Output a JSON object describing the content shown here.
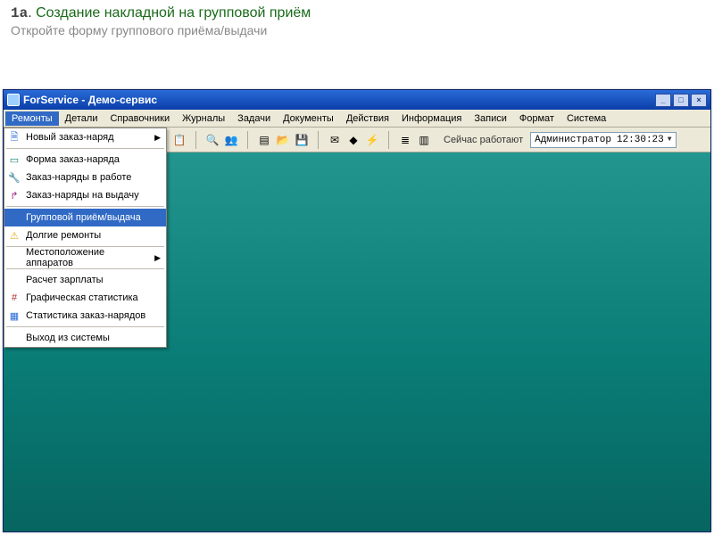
{
  "slide": {
    "number": "1a",
    "dot": ".",
    "title": "Создание накладной на групповой приём",
    "subtitle": "Откройте форму группового приёма/выдачи"
  },
  "window": {
    "title": "ForService - Демо-сервис",
    "controls": {
      "min": "_",
      "max": "□",
      "close": "×"
    }
  },
  "menubar": {
    "items": [
      "Ремонты",
      "Детали",
      "Справочники",
      "Журналы",
      "Задачи",
      "Документы",
      "Действия",
      "Информация",
      "Записи",
      "Формат",
      "Система"
    ],
    "activeIndex": 0
  },
  "dropdown": {
    "items": [
      {
        "label": "Новый заказ-наряд",
        "icon": "doc",
        "submenu": true
      },
      {
        "sep": true
      },
      {
        "label": "Форма заказ-наряда",
        "icon": "form"
      },
      {
        "label": "Заказ-наряды в работе",
        "icon": "wrench"
      },
      {
        "label": "Заказ-наряды на выдачу",
        "icon": "out"
      },
      {
        "sep": true
      },
      {
        "label": "Групповой приём/выдача",
        "selected": true
      },
      {
        "label": "Долгие ремонты",
        "icon": "warn"
      },
      {
        "sep": true
      },
      {
        "label": "Местоположение аппаратов",
        "submenu": true
      },
      {
        "sep": true
      },
      {
        "label": "Расчет зарплаты"
      },
      {
        "label": "Графическая статистика",
        "icon": "stat"
      },
      {
        "label": "Статистика заказ-нарядов",
        "icon": "table"
      },
      {
        "sep": true
      },
      {
        "label": "Выход из системы"
      }
    ]
  },
  "toolbar": {
    "status_label": "Сейчас работают",
    "user": "Администратор",
    "time": "12:30:23"
  },
  "icons": {
    "doc": "🗎",
    "form": "▭",
    "wrench": "🔧",
    "out": "↱",
    "warn": "⚠",
    "stat": "#",
    "table": "▦",
    "copy": "⧉",
    "paste": "📋",
    "search": "🔍",
    "people": "👥",
    "page": "▤",
    "folder": "📂",
    "disk": "💾",
    "mail": "✉",
    "tag": "◆",
    "bolt": "⚡",
    "list": "≣",
    "cal": "▥"
  }
}
